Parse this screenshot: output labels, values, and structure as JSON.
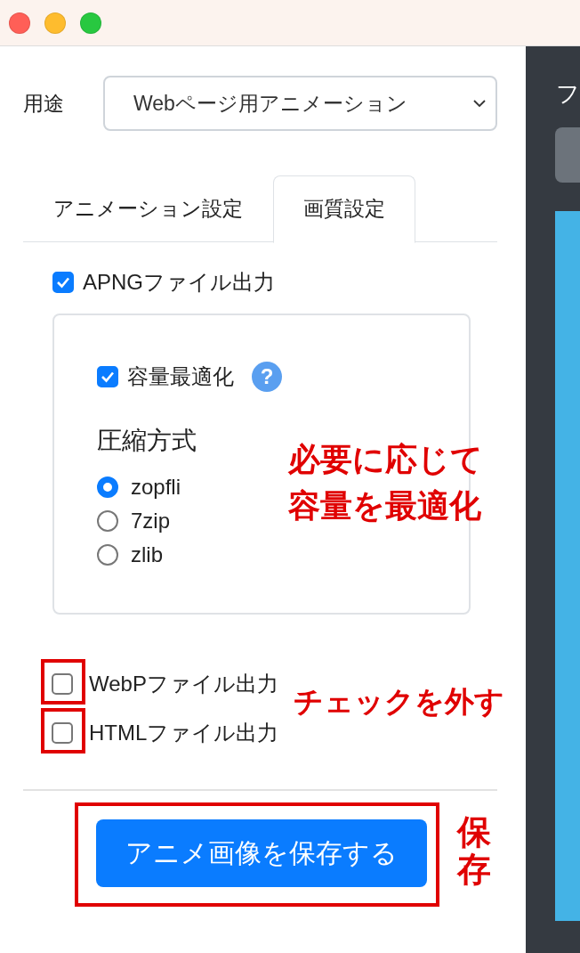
{
  "usage": {
    "label": "用途",
    "value": "Webページ用アニメーション"
  },
  "tabs": [
    {
      "label": "アニメーション設定",
      "selected": false
    },
    {
      "label": "画質設定",
      "selected": true
    }
  ],
  "apng": {
    "label": "APNGファイル出力",
    "checked": true
  },
  "optimize": {
    "label": "容量最適化",
    "checked": true,
    "help": "?"
  },
  "compression": {
    "title": "圧縮方式",
    "options": [
      {
        "label": "zopfli",
        "selected": true
      },
      {
        "label": "7zip",
        "selected": false
      },
      {
        "label": "zlib",
        "selected": false
      }
    ]
  },
  "outputs": [
    {
      "label": "WebPファイル出力",
      "checked": false
    },
    {
      "label": "HTMLファイル出力",
      "checked": false
    }
  ],
  "save_button": "アニメ画像を保存する",
  "annotations": {
    "optimize_note": [
      "必要に応じて",
      "容量を最適化"
    ],
    "uncheck_note": "チェックを外す",
    "save_note": "保存"
  },
  "side_panel": {
    "heading": "フ"
  }
}
